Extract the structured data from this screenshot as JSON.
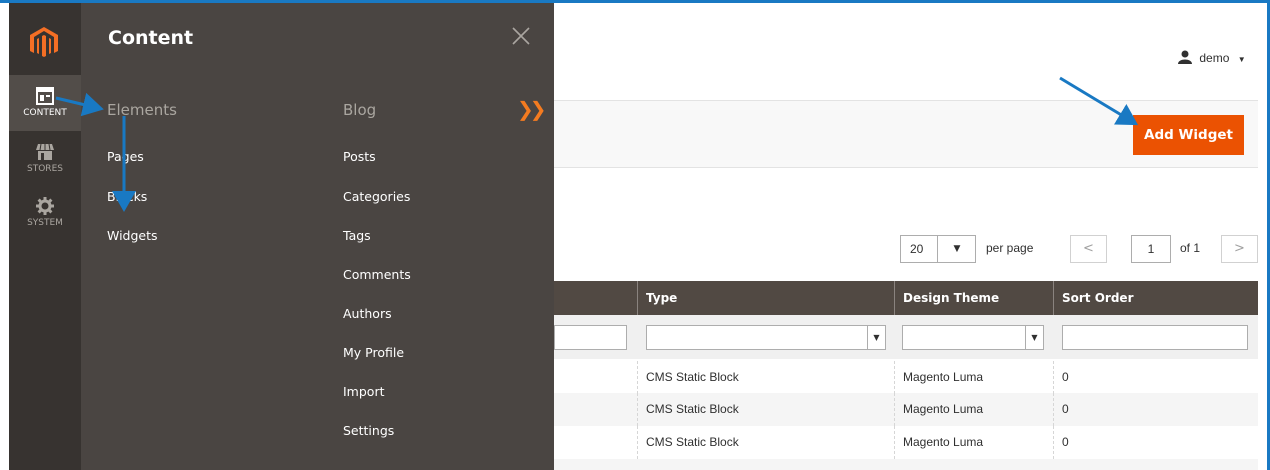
{
  "sidebar": {
    "items": [
      {
        "label": "CONTENT",
        "icon": "content-icon"
      },
      {
        "label": "STORES",
        "icon": "stores-icon"
      },
      {
        "label": "SYSTEM",
        "icon": "gear-icon"
      }
    ]
  },
  "flyout": {
    "title": "Content",
    "columns": [
      {
        "heading": "Elements",
        "items": [
          "Pages",
          "Blocks",
          "Widgets"
        ]
      },
      {
        "heading": "Blog",
        "items": [
          "Posts",
          "Categories",
          "Tags",
          "Comments",
          "Authors",
          "My Profile",
          "Import",
          "Settings"
        ]
      }
    ]
  },
  "header": {
    "user": "demo"
  },
  "actions": {
    "add_widget": "Add Widget"
  },
  "pager": {
    "per_page_value": "20",
    "per_page_label": "per page",
    "page": "1",
    "of": "of 1"
  },
  "grid": {
    "columns": [
      "Type",
      "Design Theme",
      "Sort Order"
    ],
    "rows": [
      [
        "CMS Static Block",
        "Magento Luma",
        "0"
      ],
      [
        "CMS Static Block",
        "Magento Luma",
        "0"
      ],
      [
        "CMS Static Block",
        "Magento Luma",
        "0"
      ]
    ]
  },
  "colors": {
    "accent": "#eb5202",
    "sidebar": "#373330",
    "flyout": "#4a4542",
    "annotation": "#1979c3"
  }
}
